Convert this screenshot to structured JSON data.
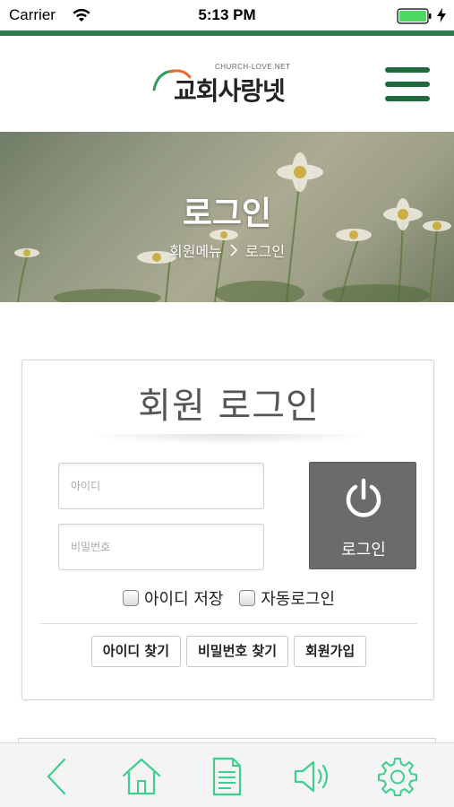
{
  "status_bar": {
    "carrier": "Carrier",
    "time": "5:13 PM",
    "battery_color": "#4cd964"
  },
  "header": {
    "logo_small": "CHURCH-LOVE.NET",
    "logo_main": "교회사랑넷",
    "menu_icon": "hamburger-menu-icon",
    "brand_color": "#1f6b3e"
  },
  "banner": {
    "title": "로그인",
    "breadcrumb": {
      "parent": "회원메뉴",
      "current": "로그인"
    }
  },
  "login": {
    "title": "회원 로그인",
    "id_placeholder": "아이디",
    "pw_placeholder": "비밀번호",
    "button_label": "로그인",
    "button_icon": "power-icon",
    "save_id_label": "아이디 저장",
    "auto_login_label": "자동로그인",
    "find_id_label": "아이디 찾기",
    "find_pw_label": "비밀번호 찾기",
    "signup_label": "회원가입"
  },
  "toolbar": {
    "accent_color": "#3ecf8e",
    "items": [
      "back-icon",
      "home-icon",
      "document-icon",
      "speaker-icon",
      "settings-icon"
    ]
  }
}
